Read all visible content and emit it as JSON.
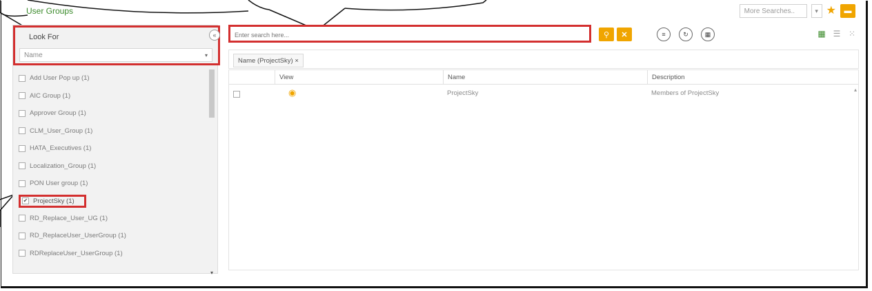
{
  "app": {
    "title": "User Groups"
  },
  "top_right": {
    "more_searches": "More Searches..",
    "dropdown_icon": "chevron-down-icon",
    "favorite_icon": "star-icon",
    "folder_icon": "folder-icon"
  },
  "left_panel": {
    "label": "Look For",
    "select_value": "Name",
    "items": [
      {
        "label": "Add User Pop up (1)",
        "checked": false
      },
      {
        "label": "AIC Group (1)",
        "checked": false
      },
      {
        "label": "Approver Group (1)",
        "checked": false
      },
      {
        "label": "CLM_User_Group (1)",
        "checked": false
      },
      {
        "label": "HATA_Executives (1)",
        "checked": false
      },
      {
        "label": "Localization_Group (1)",
        "checked": false
      },
      {
        "label": "PON User group (1)",
        "checked": false
      },
      {
        "label": "ProjectSky (1)",
        "checked": true
      },
      {
        "label": "RD_Replace_User_UG (1)",
        "checked": false
      },
      {
        "label": "RD_ReplaceUser_UserGroup (1)",
        "checked": false
      },
      {
        "label": "RDReplaceUser_UserGroup (1)",
        "checked": false
      }
    ]
  },
  "search": {
    "placeholder": "Enter search here...",
    "search_icon": "search-icon",
    "clear_icon": "close-icon"
  },
  "filter_chip": {
    "label": "Name (ProjectSky) ×"
  },
  "grid": {
    "headers": [
      "View",
      "Name",
      "Description"
    ],
    "rows": [
      {
        "name": "ProjectSky",
        "description": "Members of ProjectSky"
      }
    ]
  },
  "colors": {
    "accent": "#f0a500",
    "highlight": "#d32f2f",
    "title_green": "#3a8a2a"
  }
}
